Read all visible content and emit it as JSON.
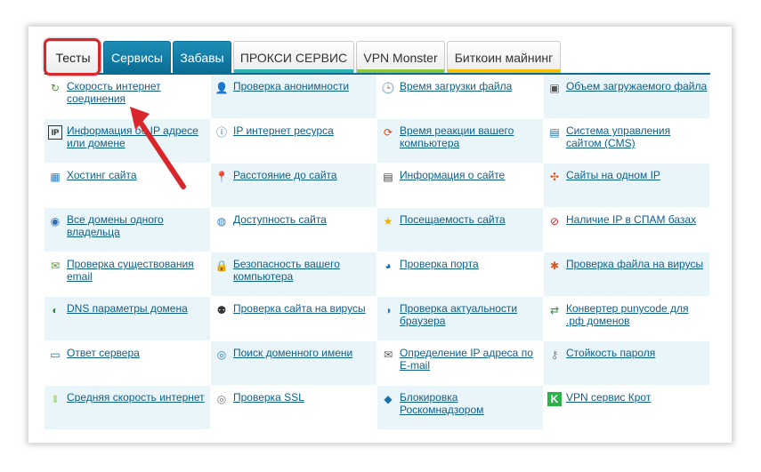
{
  "tabs": [
    {
      "label": "Тесты",
      "style": "first",
      "accent": ""
    },
    {
      "label": "Сервисы",
      "style": "blue s",
      "accent": ""
    },
    {
      "label": "Забавы",
      "style": "blue z",
      "accent": ""
    },
    {
      "label": "ПРОКСИ СЕРВИС",
      "style": "p",
      "accent": "#2bb3b0"
    },
    {
      "label": "VPN Monster",
      "style": "v",
      "accent": "#8cc63f"
    },
    {
      "label": "Биткоин майнинг",
      "style": "b",
      "accent": "#f2c200"
    }
  ],
  "tools": [
    {
      "label": "Скорость интернет соединения",
      "icon": "refresh-arrow-icon",
      "glyph": "↻",
      "color": "#4c9a2a"
    },
    {
      "label": "Проверка анонимности",
      "icon": "person-icon",
      "glyph": "👤",
      "color": "#555"
    },
    {
      "label": "Время загрузки файла",
      "icon": "clock-icon",
      "glyph": "🕒",
      "color": "#555"
    },
    {
      "label": "Объем загружаемого файла",
      "icon": "frame-icon",
      "glyph": "▣",
      "color": "#555"
    },
    {
      "label": "Информация об IP адресе или домене",
      "icon": "ip-badge-icon",
      "glyph": "IP",
      "color": "#222"
    },
    {
      "label": "IP интернет ресурса",
      "icon": "ip-circle-icon",
      "glyph": "ⓘ",
      "color": "#1b6fa8"
    },
    {
      "label": "Время реакции вашего компьютера",
      "icon": "sync-icon",
      "glyph": "⟳",
      "color": "#d84a1b"
    },
    {
      "label": "Система управления сайтом (CMS)",
      "icon": "monitor-icon",
      "glyph": "▤",
      "color": "#1b6fa8"
    },
    {
      "label": "Хостинг сайта",
      "icon": "grid-icon",
      "glyph": "▦",
      "color": "#2a7fc0"
    },
    {
      "label": "Расстояние до сайта",
      "icon": "map-pin-icon",
      "glyph": "📍",
      "color": "#d33"
    },
    {
      "label": "Информация о сайте",
      "icon": "document-icon",
      "glyph": "▤",
      "color": "#444"
    },
    {
      "label": "Сайты на одном IP",
      "icon": "network-icon",
      "glyph": "✣",
      "color": "#e0541b"
    },
    {
      "label": "Все домены одного владельца",
      "icon": "globe-user-icon",
      "glyph": "◉",
      "color": "#2a6fb0"
    },
    {
      "label": "Доступность сайта",
      "icon": "globe-icon",
      "glyph": "◍",
      "color": "#2a7fc0"
    },
    {
      "label": "Посещаемость сайта",
      "icon": "star-icon",
      "glyph": "★",
      "color": "#f0b000"
    },
    {
      "label": "Наличие IP в СПАМ базах",
      "icon": "no-entry-icon",
      "glyph": "⊘",
      "color": "#d32020"
    },
    {
      "label": "Проверка существования email",
      "icon": "email-check-icon",
      "glyph": "✉",
      "color": "#4c9a2a"
    },
    {
      "label": "Безопасность вашего компьютера",
      "icon": "lock-icon",
      "glyph": "🔒",
      "color": "#e0a000"
    },
    {
      "label": "Проверка порта",
      "icon": "port-globe-icon",
      "glyph": "◕",
      "color": "#1b6fa8"
    },
    {
      "label": "Проверка файла на вирусы",
      "icon": "virus-icon",
      "glyph": "✱",
      "color": "#e0541b"
    },
    {
      "label": "DNS параметры домена",
      "icon": "dns-icon",
      "glyph": "◐",
      "color": "#2a8a3a"
    },
    {
      "label": "Проверка сайта на вирусы",
      "icon": "bug-person-icon",
      "glyph": "⚉",
      "color": "#333"
    },
    {
      "label": "Проверка актуальности браузера",
      "icon": "browser-icon",
      "glyph": "◑",
      "color": "#2a7fc0"
    },
    {
      "label": "Конвертер punycode для .рф доменов",
      "icon": "converter-icon",
      "glyph": "⇄",
      "color": "#2a8a3a"
    },
    {
      "label": "Ответ сервера",
      "icon": "server-icon",
      "glyph": "▭",
      "color": "#1b6fa8"
    },
    {
      "label": "Поиск доменного имени",
      "icon": "search-globe-icon",
      "glyph": "◎",
      "color": "#2a7fc0"
    },
    {
      "label": "Определение IP адреса по E-mail",
      "icon": "mail-ip-icon",
      "glyph": "✉",
      "color": "#555"
    },
    {
      "label": "Стойкость пароля",
      "icon": "key-icon",
      "glyph": "⚷",
      "color": "#888"
    },
    {
      "label": "Средняя скорость интернет",
      "icon": "speed-bars-icon",
      "glyph": "‖",
      "color": "#8cc63f"
    },
    {
      "label": "Проверка SSL",
      "icon": "ssl-icon",
      "glyph": "◎",
      "color": "#777"
    },
    {
      "label": "Блокировка Роскомнадзором",
      "icon": "block-diamond-icon",
      "glyph": "◆",
      "color": "#1b6fa8"
    },
    {
      "label": "VPN сервис Крот",
      "icon": "vpn-k-icon",
      "glyph": "K",
      "color": "#ffffff"
    }
  ]
}
